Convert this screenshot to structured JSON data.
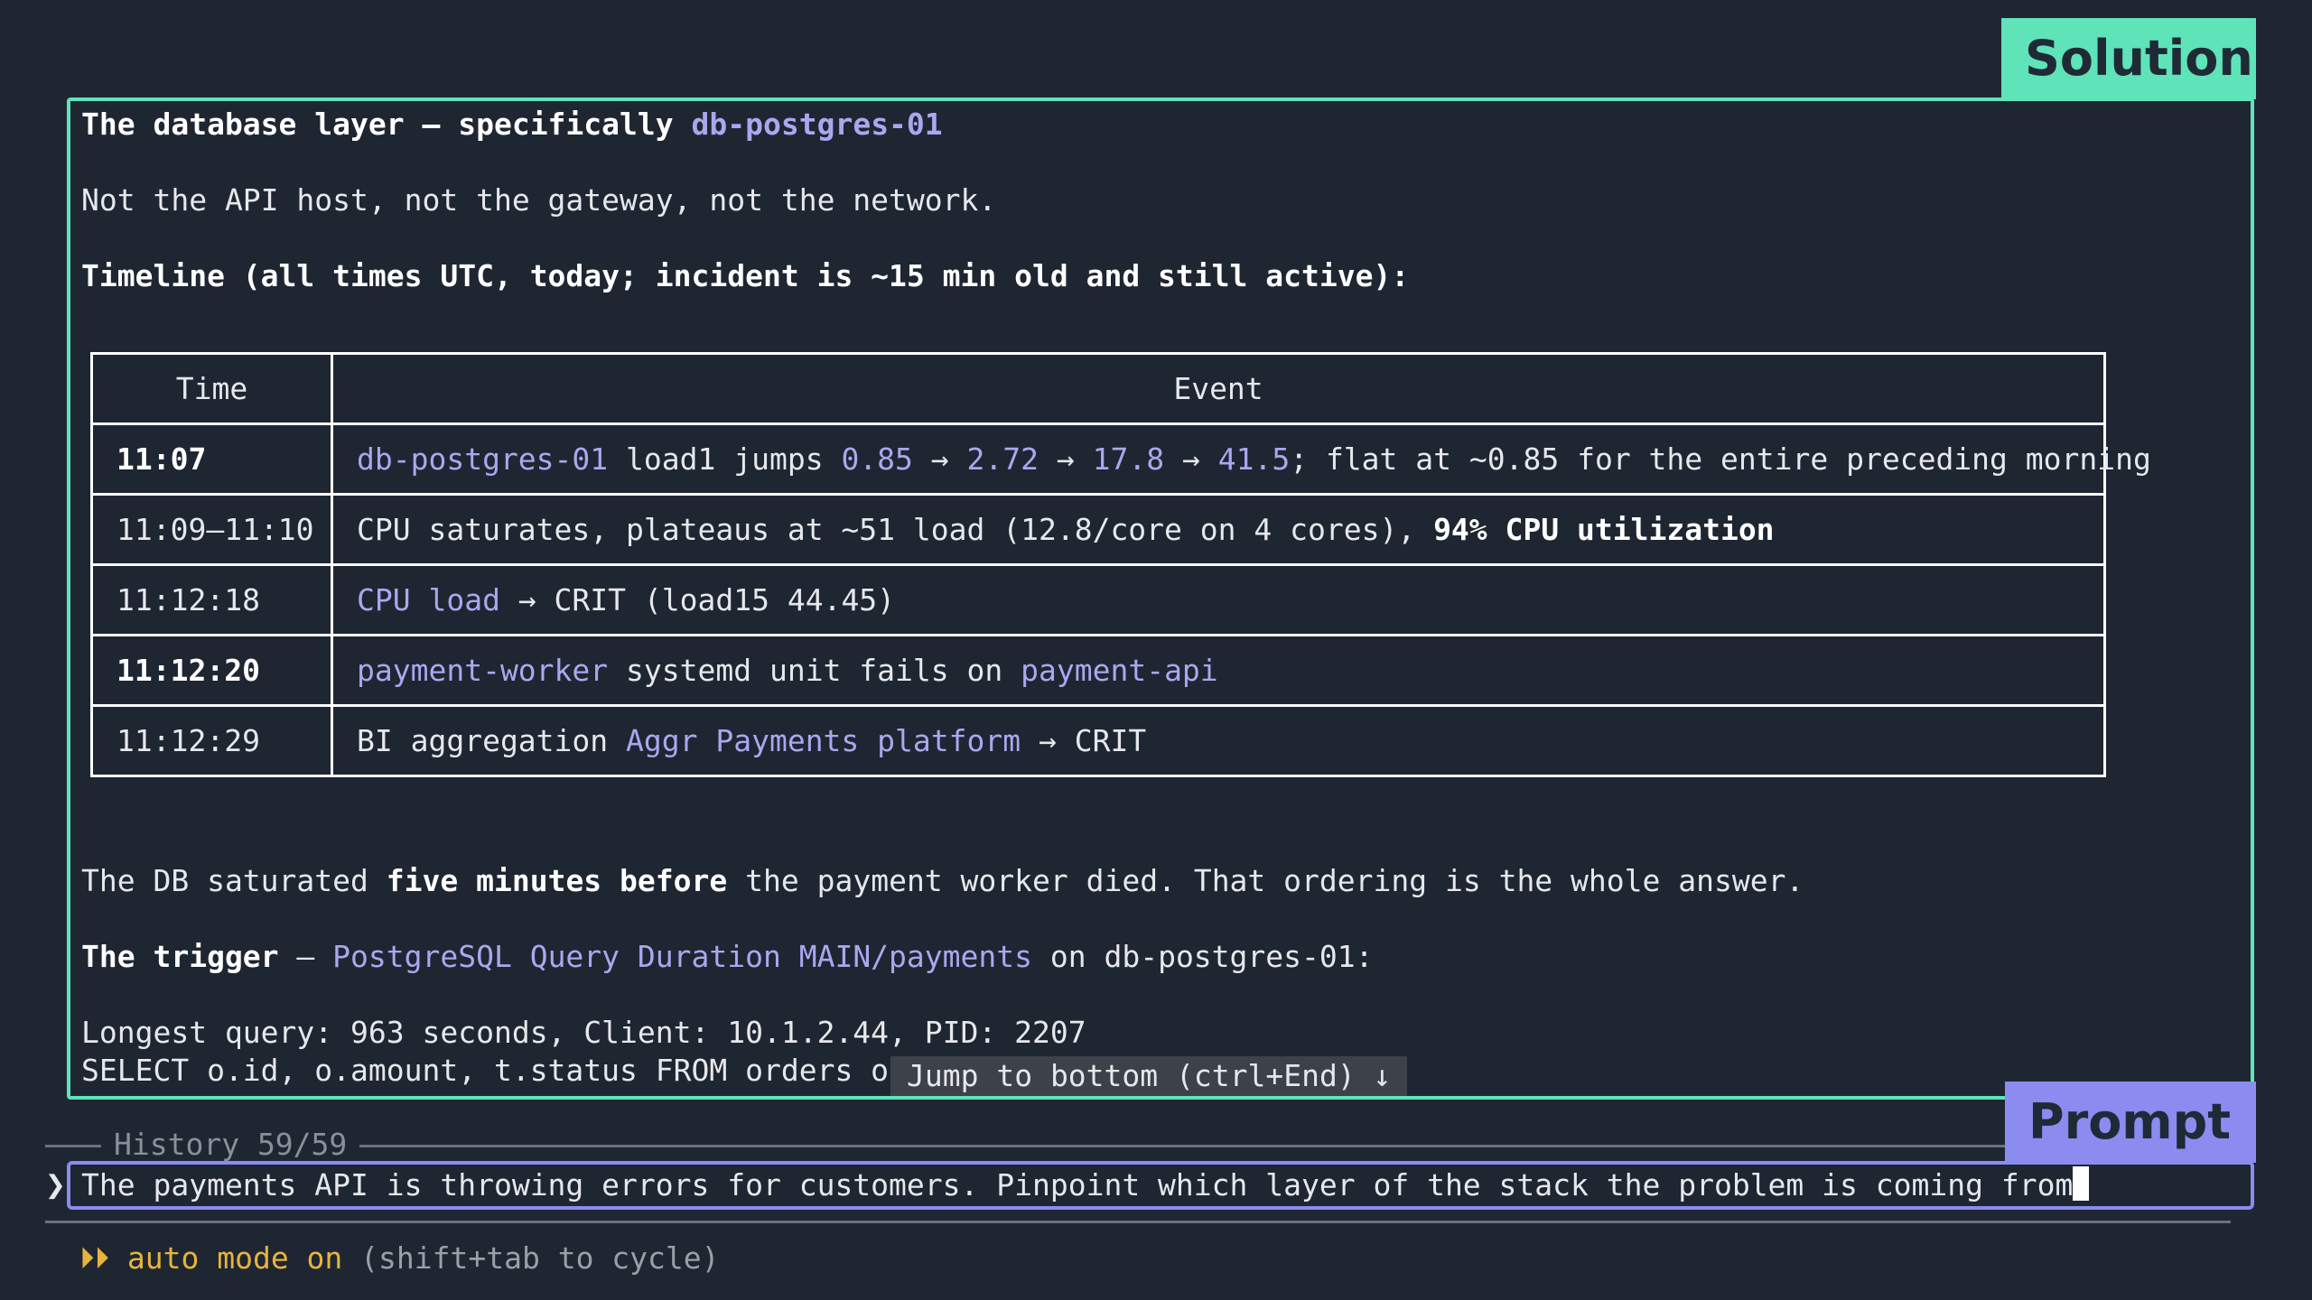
{
  "labels": {
    "solution": "Solution",
    "prompt": "Prompt"
  },
  "solution": {
    "heading_prefix": "The database layer — specifically ",
    "heading_host": "db-postgres-01",
    "not_line": "Not the API host, not the gateway, not the network.",
    "timeline_heading": "Timeline (all times UTC, today; incident is ~15 min old and still active):",
    "table": {
      "headers": [
        "Time",
        "Event"
      ],
      "rows": [
        {
          "time": "11:07",
          "segments": [
            {
              "text": "db-postgres-01",
              "style": "link"
            },
            {
              "text": " load1 jumps ",
              "style": "plain"
            },
            {
              "text": "0.85",
              "style": "link"
            },
            {
              "text": " → ",
              "style": "plain"
            },
            {
              "text": "2.72",
              "style": "link"
            },
            {
              "text": " → ",
              "style": "plain"
            },
            {
              "text": "17.8",
              "style": "link"
            },
            {
              "text": " → ",
              "style": "plain"
            },
            {
              "text": "41.5",
              "style": "link"
            },
            {
              "text": "; flat at ~0.85 for the entire preceding morning",
              "style": "plain"
            }
          ]
        },
        {
          "time": "11:09–11:10",
          "segments": [
            {
              "text": "CPU saturates, plateaus at ~51 load (12.8/core on 4 cores), ",
              "style": "plain"
            },
            {
              "text": "94% CPU utilization",
              "style": "bold"
            }
          ]
        },
        {
          "time": "11:12:18",
          "segments": [
            {
              "text": "CPU load",
              "style": "link"
            },
            {
              "text": " → CRIT (load15 44.45)",
              "style": "plain"
            }
          ]
        },
        {
          "time": "11:12:20",
          "segments": [
            {
              "text": "payment-worker",
              "style": "link"
            },
            {
              "text": " systemd unit fails on ",
              "style": "plain"
            },
            {
              "text": "payment-api",
              "style": "link"
            }
          ]
        },
        {
          "time": "11:12:29",
          "segments": [
            {
              "text": "BI aggregation ",
              "style": "plain"
            },
            {
              "text": "Aggr Payments platform",
              "style": "link"
            },
            {
              "text": " → CRIT",
              "style": "plain"
            }
          ]
        }
      ]
    },
    "conclusion_prefix": "The DB saturated ",
    "conclusion_bold": "five minutes before",
    "conclusion_suffix": " the payment worker died. That ordering is the whole answer.",
    "trigger_label": "The trigger",
    "trigger_dash": " — ",
    "trigger_link": "PostgreSQL Query Duration MAIN/payments",
    "trigger_suffix": " on db-postgres-01:",
    "longest_query": "Longest query: 963 seconds, Client: 10.1.2.44, PID: 2207",
    "select_line": "SELECT o.id, o.amount, t.status FROM orders o",
    "jump_to_bottom": "Jump to bottom (ctrl+End) ↓"
  },
  "history": {
    "label": "History 59/59"
  },
  "prompt": {
    "caret": "❯",
    "text": "The payments API is throwing errors for customers. Pinpoint which layer of the stack the problem is coming from"
  },
  "status": {
    "arrows": "⏵⏵",
    "mode": "auto mode on",
    "hint": " (shift+tab to cycle)"
  }
}
